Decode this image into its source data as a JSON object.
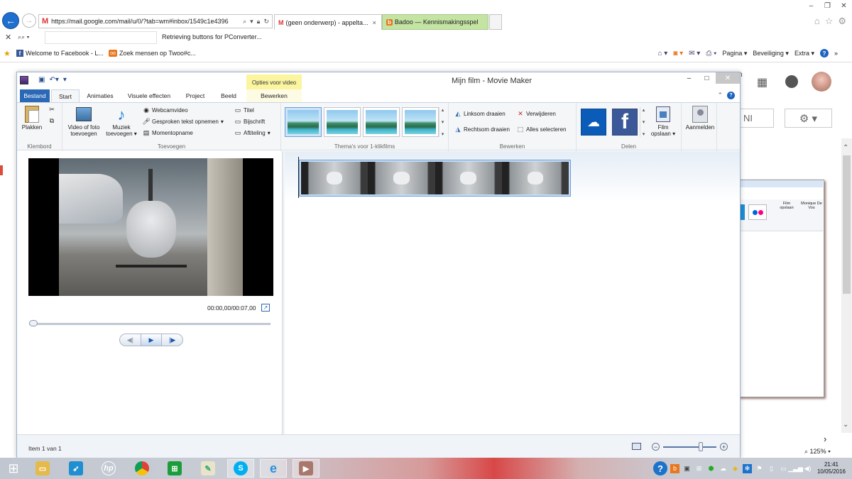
{
  "browser": {
    "address": "https://mail.google.com/mail/u/0/?tab=wm#inbox/1549c1e4396",
    "tabs": [
      {
        "label": "(geen onderwerp) - appelta..."
      },
      {
        "label": "Badoo — Kennismakingsspel"
      }
    ],
    "search_status": "Retrieving buttons for PConverter...",
    "favorites": [
      {
        "label": "Welcome to Facebook - L..."
      },
      {
        "label": "Zoek mensen op Twoo#c..."
      }
    ],
    "commands": {
      "page": "Pagina",
      "security": "Beveiliging",
      "extra": "Extra"
    },
    "zoom": "125%"
  },
  "gmail": {
    "lang_button": "NI",
    "preview": {
      "film_label": "Film opslaan",
      "user_label": "Monique De Vos"
    }
  },
  "moviemaker": {
    "title": "Mijn film - Movie Maker",
    "context_tab_header": "Opties voor video",
    "tabs": [
      "Bestand",
      "Start",
      "Animaties",
      "Visuele effecten",
      "Project",
      "Beeld",
      "Bewerken"
    ],
    "groups": {
      "clipboard": {
        "label": "Klembord",
        "paste": "Plakken"
      },
      "add": {
        "label": "Toevoegen",
        "add_video": "Video of foto toevoegen",
        "add_music": "Muziek toevoegen",
        "webcam": "Webcamvideo",
        "narration": "Gesproken tekst opnemen",
        "snapshot": "Momentopname",
        "title": "Titel",
        "caption": "Bijschrift",
        "credits": "Aftiteling"
      },
      "themes": {
        "label": "Thema's voor 1-klikfilms"
      },
      "edit": {
        "label": "Bewerken",
        "rotate_left": "Linksom draaien",
        "rotate_right": "Rechtsom draaien",
        "delete": "Verwijderen",
        "select_all": "Alles selecteren"
      },
      "share": {
        "label": "Delen",
        "save_film": "Film opslaan"
      },
      "signin": {
        "label": "Aanmelden"
      }
    },
    "player": {
      "time": "00:00,00/00:07,00"
    },
    "status": {
      "item": "Item 1 van 1"
    }
  },
  "taskbar": {
    "time": "21:41",
    "date": "10/05/2016"
  }
}
